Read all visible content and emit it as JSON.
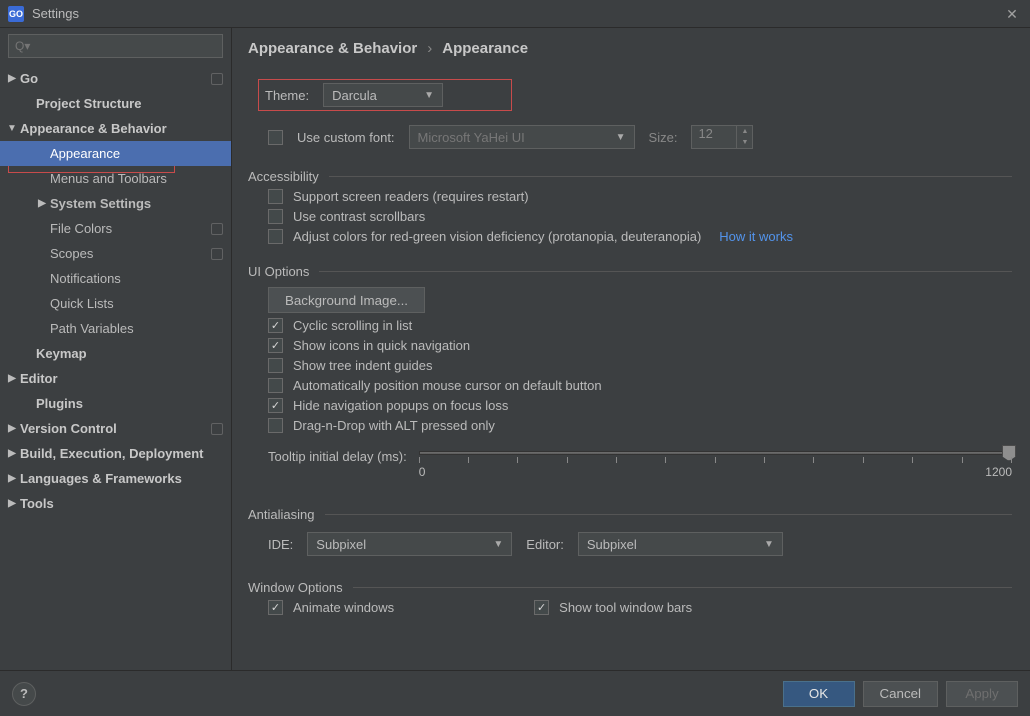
{
  "titlebar": {
    "logo": "GO",
    "title": "Settings"
  },
  "search": {
    "placeholder": "Q▾"
  },
  "tree": {
    "go": "Go",
    "project_structure": "Project Structure",
    "appearance_behavior": "Appearance & Behavior",
    "appearance": "Appearance",
    "menus_toolbars": "Menus and Toolbars",
    "system_settings": "System Settings",
    "file_colors": "File Colors",
    "scopes": "Scopes",
    "notifications": "Notifications",
    "quick_lists": "Quick Lists",
    "path_variables": "Path Variables",
    "keymap": "Keymap",
    "editor": "Editor",
    "plugins": "Plugins",
    "version_control": "Version Control",
    "build": "Build, Execution, Deployment",
    "lang_fw": "Languages & Frameworks",
    "tools": "Tools"
  },
  "crumb": {
    "a": "Appearance & Behavior",
    "b": "Appearance"
  },
  "theme": {
    "label": "Theme:",
    "value": "Darcula"
  },
  "font": {
    "use_custom": "Use custom font:",
    "value": "Microsoft YaHei UI",
    "size_label": "Size:",
    "size_value": "12"
  },
  "accessibility": {
    "title": "Accessibility",
    "screen_readers": "Support screen readers (requires restart)",
    "contrast_scroll": "Use contrast scrollbars",
    "adjust_colors": "Adjust colors for red-green vision deficiency (protanopia, deuteranopia)",
    "how_it_works": "How it works"
  },
  "ui_options": {
    "title": "UI Options",
    "bg_image": "Background Image...",
    "cyclic": "Cyclic scrolling in list",
    "icons_quicknav": "Show icons in quick navigation",
    "tree_indent": "Show tree indent guides",
    "auto_cursor": "Automatically position mouse cursor on default button",
    "hide_popups": "Hide navigation popups on focus loss",
    "dnd_alt": "Drag-n-Drop with ALT pressed only",
    "tooltip_label": "Tooltip initial delay (ms):",
    "tooltip_min": "0",
    "tooltip_max": "1200"
  },
  "antialiasing": {
    "title": "Antialiasing",
    "ide_label": "IDE:",
    "ide_value": "Subpixel",
    "editor_label": "Editor:",
    "editor_value": "Subpixel"
  },
  "window_options": {
    "title": "Window Options",
    "animate": "Animate windows",
    "show_toolbars": "Show tool window bars"
  },
  "footer": {
    "ok": "OK",
    "cancel": "Cancel",
    "apply": "Apply"
  }
}
